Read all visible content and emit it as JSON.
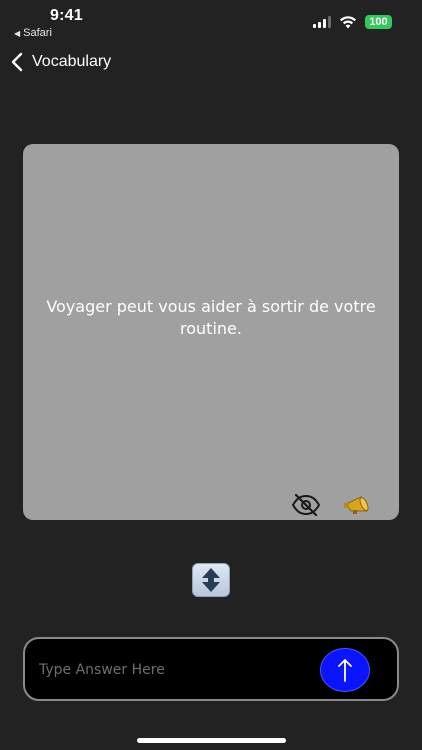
{
  "status_bar": {
    "time": "9:41",
    "back_app": "Safari",
    "battery": "100"
  },
  "nav": {
    "title": "Vocabulary"
  },
  "card": {
    "text": "Voyager peut vous aider à sortir de votre routine.",
    "icons": [
      "eye-slash-icon",
      "megaphone-icon"
    ]
  },
  "flip": {
    "icon": "up-down-arrow-icon"
  },
  "answer": {
    "placeholder": "Type Answer Here",
    "value": ""
  },
  "colors": {
    "background": "#222222",
    "card": "#a0a0a0",
    "send_button": "#0a14ff",
    "battery": "#34c759"
  }
}
